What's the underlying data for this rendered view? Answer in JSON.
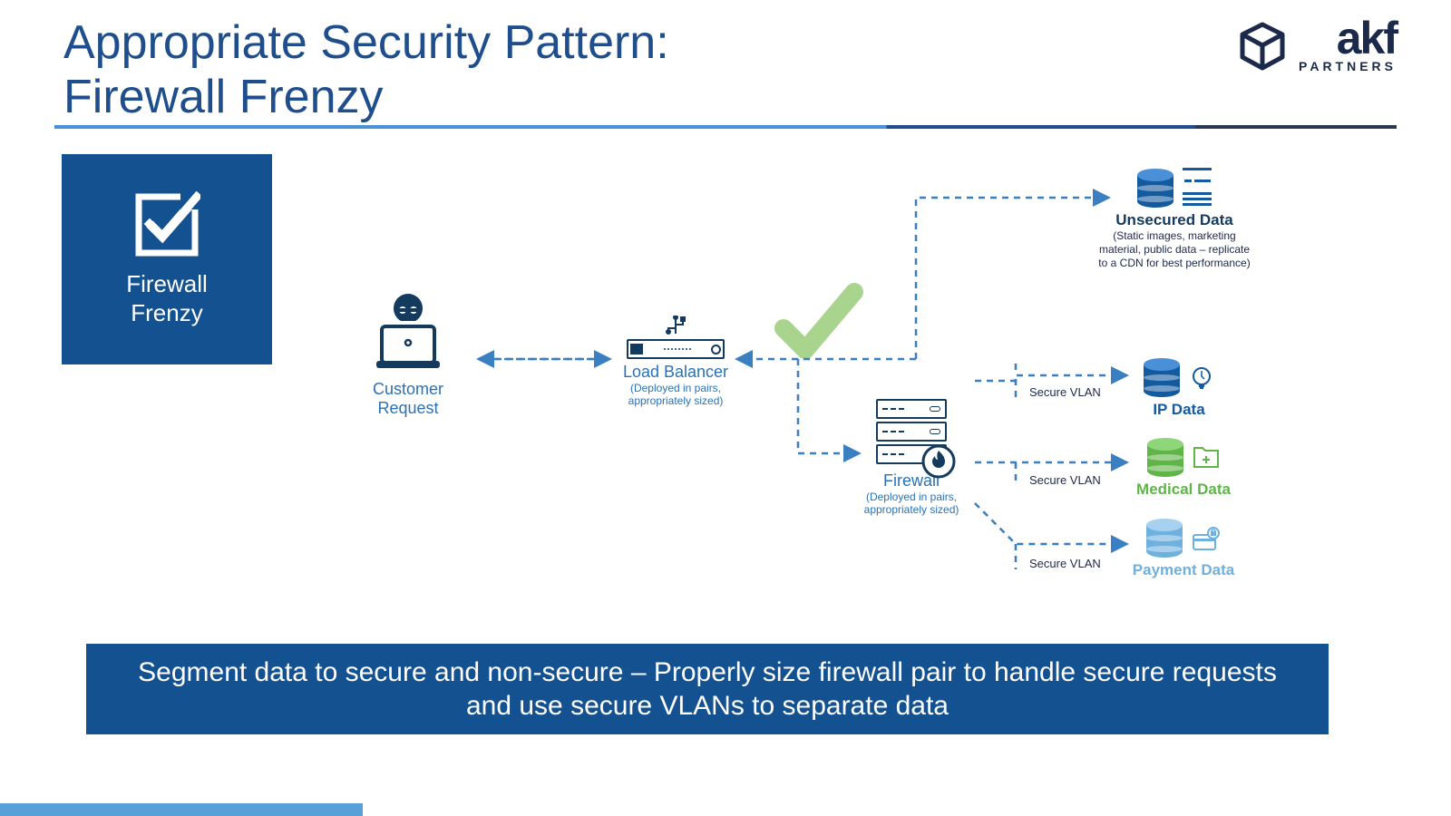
{
  "title_line1": "Appropriate Security Pattern:",
  "title_line2": "Firewall Frenzy",
  "logo": {
    "brand": "akf",
    "sub": "PARTNERS"
  },
  "badge": "Firewall\nFrenzy",
  "customer": {
    "label": "Customer\nRequest"
  },
  "lb": {
    "label": "Load Balancer",
    "sub": "(Deployed in pairs,\nappropriately sized)"
  },
  "firewall": {
    "label": "Firewall",
    "sub": "(Deployed in pairs,\nappropriately sized)"
  },
  "unsecured": {
    "title": "Unsecured Data",
    "note": "(Static images, marketing material, public data – replicate to a CDN for best performance)"
  },
  "vlan": "Secure VLAN",
  "ip": "IP Data",
  "medical": "Medical Data",
  "payment": "Payment Data",
  "footer": "Segment data to secure and non-secure – Properly size firewall pair to handle secure requests and use secure VLANs to separate data",
  "colors": {
    "ip": "#145a9e",
    "medical": "#5fb548",
    "payment": "#6eb0de",
    "dark": "#143a5e",
    "check": "#a9d48e"
  }
}
